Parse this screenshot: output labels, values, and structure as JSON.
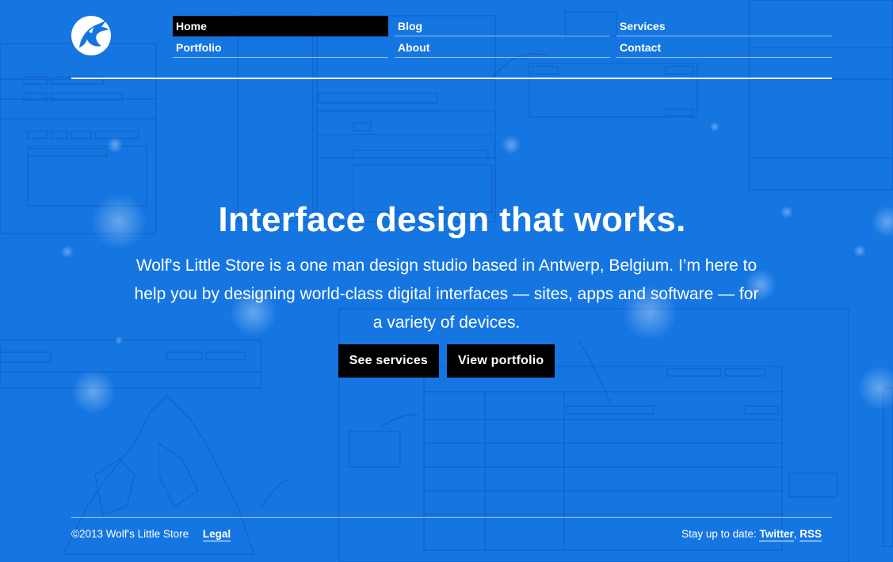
{
  "nav": {
    "col1": [
      {
        "label": "Home",
        "active": true
      },
      {
        "label": "Portfolio",
        "active": false
      }
    ],
    "col2": [
      {
        "label": "Blog",
        "active": false
      },
      {
        "label": "About",
        "active": false
      }
    ],
    "col3": [
      {
        "label": "Services",
        "active": false
      },
      {
        "label": "Contact",
        "active": false
      }
    ]
  },
  "hero": {
    "title": "Interface design that works.",
    "description": "Wolf's Little Store is a one man design studio based in Antwerp, Belgium. I’m here to help you by designing world-class digital interfaces — sites, apps and software — for a variety of devices.",
    "primary_button": "See services",
    "secondary_button": "View portfolio"
  },
  "footer": {
    "copyright": "©2013 Wolf's Little Store",
    "legal": "Legal",
    "stay_up_to_date": "Stay up to date:",
    "twitter": "Twitter",
    "separator": ",",
    "rss": "RSS"
  },
  "icons": {
    "logo": "wolf-head-icon"
  },
  "colors": {
    "background": "#1576e2",
    "button": "#000000",
    "text": "#ffffff"
  }
}
